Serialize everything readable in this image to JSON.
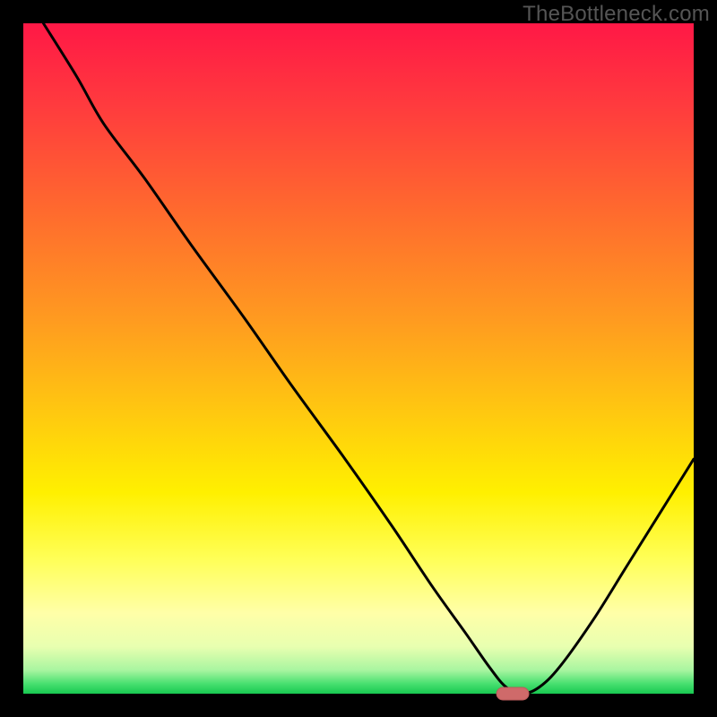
{
  "watermark": "TheBottleneck.com",
  "colors": {
    "frame": "#000000",
    "curve_stroke": "#000000",
    "marker_fill": "#cf6a6a",
    "marker_stroke": "#b95a5a",
    "gradient_stops": [
      {
        "offset": 0.0,
        "color": "#ff1846"
      },
      {
        "offset": 0.12,
        "color": "#ff3a3e"
      },
      {
        "offset": 0.28,
        "color": "#ff6a2e"
      },
      {
        "offset": 0.44,
        "color": "#ff9a20"
      },
      {
        "offset": 0.58,
        "color": "#ffc810"
      },
      {
        "offset": 0.7,
        "color": "#fff000"
      },
      {
        "offset": 0.8,
        "color": "#ffff58"
      },
      {
        "offset": 0.88,
        "color": "#ffffa8"
      },
      {
        "offset": 0.93,
        "color": "#e8ffb0"
      },
      {
        "offset": 0.965,
        "color": "#a8f5a0"
      },
      {
        "offset": 0.985,
        "color": "#48e070"
      },
      {
        "offset": 1.0,
        "color": "#18c850"
      }
    ]
  },
  "chart_data": {
    "type": "line",
    "title": "",
    "xlabel": "",
    "ylabel": "",
    "xlim": [
      0,
      100
    ],
    "ylim": [
      0,
      100
    ],
    "marker": {
      "x": 73,
      "y": 0
    },
    "x": [
      3,
      8,
      12,
      18,
      25,
      33,
      40,
      48,
      55,
      61,
      66,
      69.5,
      72,
      74.5,
      77,
      80,
      85,
      90,
      95,
      100
    ],
    "values": [
      100,
      92,
      85,
      77,
      67,
      56,
      46,
      35,
      25,
      16,
      9,
      4,
      1,
      0,
      1,
      4,
      11,
      19,
      27,
      35
    ]
  }
}
